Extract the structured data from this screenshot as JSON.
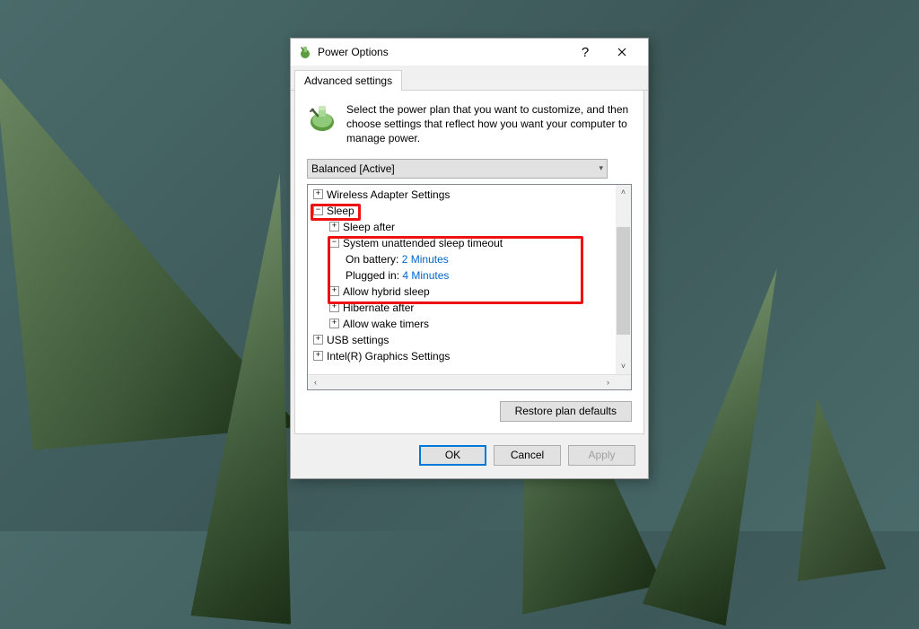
{
  "titlebar": {
    "title": "Power Options",
    "help": "?",
    "close": "✕"
  },
  "tabs": {
    "advanced": "Advanced settings"
  },
  "intro": "Select the power plan that you want to customize, and then choose settings that reflect how you want your computer to manage power.",
  "plan_select": {
    "value": "Balanced [Active]"
  },
  "tree": {
    "wireless": "Wireless Adapter Settings",
    "sleep": "Sleep",
    "sleep_after": "Sleep after",
    "sys_unattended": "System unattended sleep timeout",
    "on_battery_label": "On battery:",
    "on_battery_value": "2 Minutes",
    "plugged_in_label": "Plugged in:",
    "plugged_in_value": "4 Minutes",
    "allow_hybrid": "Allow hybrid sleep",
    "hibernate_after": "Hibernate after",
    "allow_wake": "Allow wake timers",
    "usb": "USB settings",
    "intel": "Intel(R) Graphics Settings"
  },
  "buttons": {
    "restore": "Restore plan defaults",
    "ok": "OK",
    "cancel": "Cancel",
    "apply": "Apply"
  }
}
